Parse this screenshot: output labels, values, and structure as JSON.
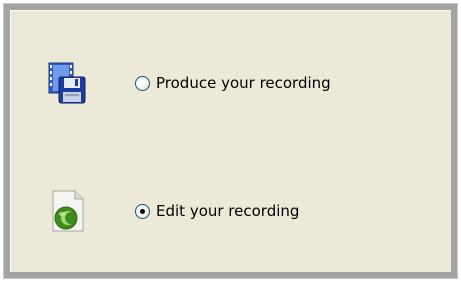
{
  "options": [
    {
      "label": "Produce your recording",
      "selected": false,
      "icon": "film-floppy-icon"
    },
    {
      "label": "Edit your recording",
      "selected": true,
      "icon": "camtasia-document-icon"
    }
  ],
  "colors": {
    "panel_background": "#ece9d8",
    "frame_border": "#a4a4a4",
    "film_blue": "#3c6fd8",
    "floppy_blue": "#1b3c9e",
    "green": "#4f9a24"
  }
}
